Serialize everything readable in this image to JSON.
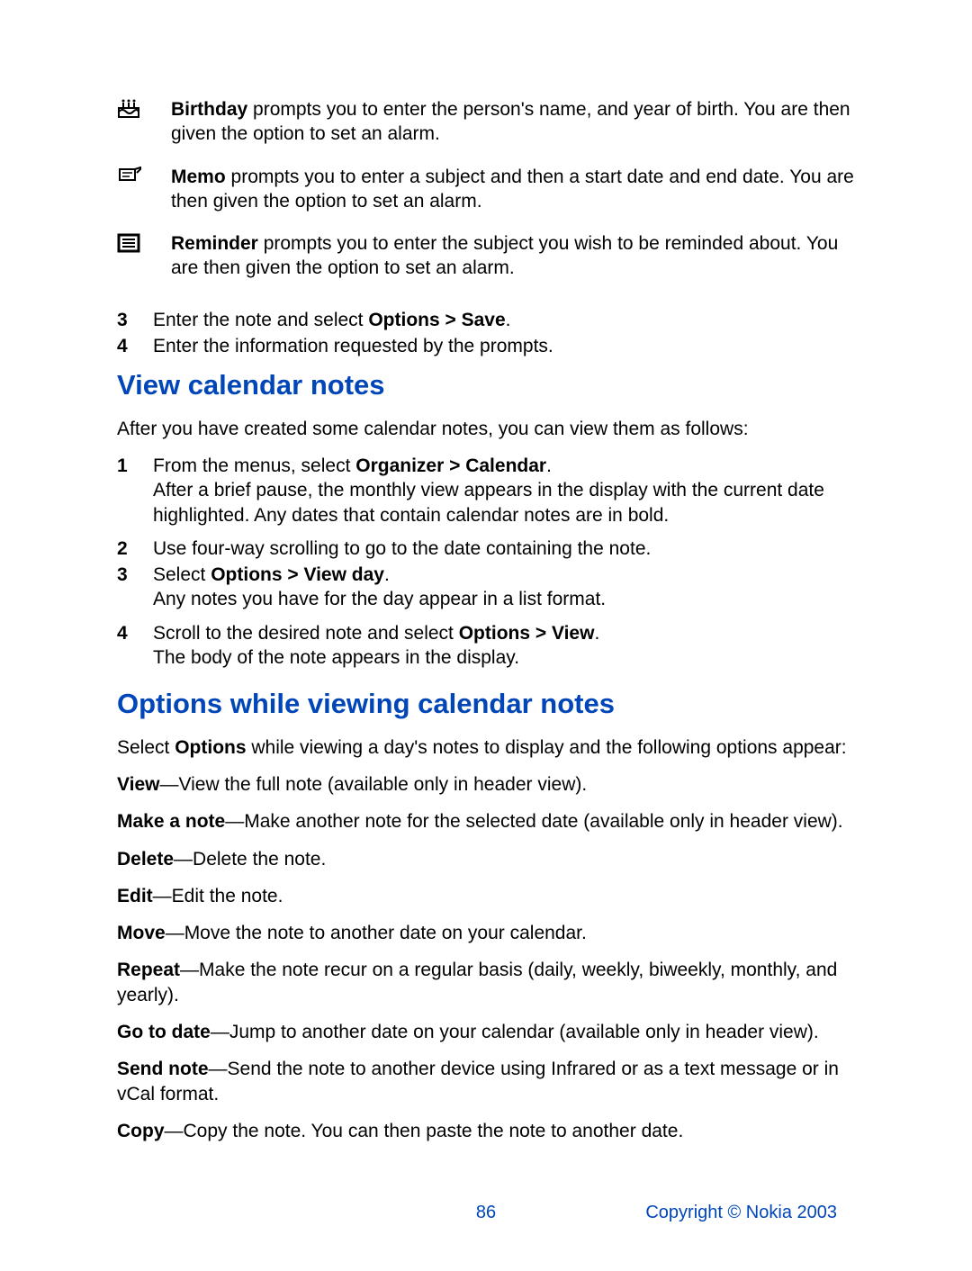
{
  "noteTypes": {
    "birthday": {
      "label": "Birthday",
      "desc": " prompts you to enter the person's name, and year of birth. You are then given the option to set an alarm."
    },
    "memo": {
      "label": "Memo",
      "desc": " prompts you to enter a subject and then a start date and end date. You are then given the option to set an alarm."
    },
    "reminder": {
      "label": "Reminder",
      "desc": " prompts you to enter the subject you wish to be reminded about. You are then given the option to set an alarm."
    }
  },
  "steps1": {
    "n3a": "3",
    "t3a_pre": "Enter the note and select ",
    "t3a_bold": "Options > Save",
    "t3a_post": ".",
    "n4a": "4",
    "t4a": "Enter the information requested by the prompts."
  },
  "heading1": "View calendar notes",
  "intro1": "After you have created some calendar notes, you can view them as follows:",
  "viewSteps": {
    "n1": "1",
    "s1_pre": "From the menus, select ",
    "s1_bold": "Organizer > Calendar",
    "s1_post": ".",
    "s1_line2": "After a brief pause, the monthly view appears in the display with the current date highlighted. Any dates that contain calendar notes are in bold.",
    "n2": "2",
    "s2": "Use four-way scrolling to go to the date containing the note.",
    "n3": "3",
    "s3_pre": "Select ",
    "s3_bold": "Options > View day",
    "s3_post": ".",
    "s3_line2": "Any notes you have for the day appear in a list format.",
    "n4": "4",
    "s4_pre": "Scroll to the desired note and select ",
    "s4_bold": "Options > View",
    "s4_post": ".",
    "s4_line2": "The body of the note appears in the display."
  },
  "heading2": "Options while viewing calendar notes",
  "intro2_pre": "Select ",
  "intro2_bold": "Options",
  "intro2_post": " while viewing a day's notes to display and the following options appear:",
  "options": {
    "view": {
      "label": "View",
      "desc": "—View the full note (available only in header view)."
    },
    "make": {
      "label": "Make a note",
      "desc": "—Make another note for the selected date (available only in header view)."
    },
    "delete": {
      "label": "Delete",
      "desc": "—Delete the note."
    },
    "edit": {
      "label": "Edit",
      "desc": "—Edit the note."
    },
    "move": {
      "label": "Move",
      "desc": "—Move the note to another date on your calendar."
    },
    "repeat": {
      "label": "Repeat",
      "desc": "—Make the note recur on a regular basis (daily, weekly, biweekly, monthly, and yearly)."
    },
    "goto": {
      "label": "Go to date",
      "desc": "—Jump to another date on your calendar (available only in header view)."
    },
    "send": {
      "label": "Send note",
      "desc": "—Send the note to another device using Infrared or as a text message or in vCal format."
    },
    "copy": {
      "label": "Copy",
      "desc": "—Copy the note. You can then paste the note to another date."
    }
  },
  "pageNumber": "86",
  "copyright": "Copyright © Nokia 2003"
}
